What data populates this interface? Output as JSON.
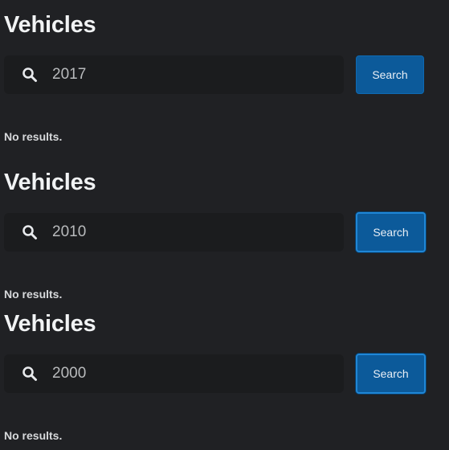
{
  "sections": [
    {
      "title": "Vehicles",
      "search_value": "2017",
      "search_label": "Search",
      "status": "No results."
    },
    {
      "title": "Vehicles",
      "search_value": "2010",
      "search_label": "Search",
      "status": "No results."
    },
    {
      "title": "Vehicles",
      "search_value": "2000",
      "search_label": "Search",
      "status": "No results."
    }
  ],
  "icons": {
    "search": "search-icon"
  },
  "colors": {
    "background": "#202124",
    "button": "#0c5a9a",
    "button_focus_border": "#1f86d6"
  }
}
